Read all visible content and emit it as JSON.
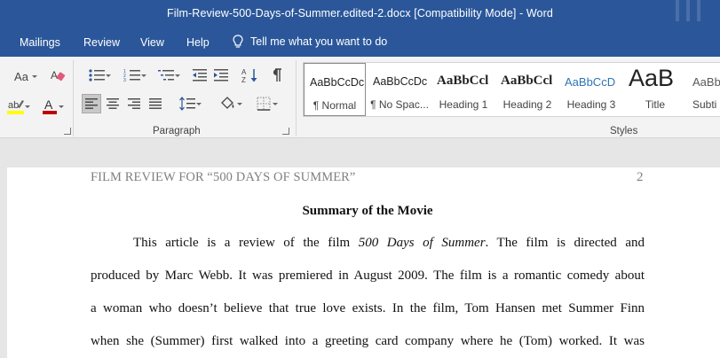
{
  "window": {
    "title": "Film-Review-500-Days-of-Summer.edited-2.docx [Compatibility Mode]  -  Word"
  },
  "menu": {
    "tabs": [
      "Mailings",
      "Review",
      "View",
      "Help"
    ],
    "tell_me": "Tell me what you want to do"
  },
  "ribbon": {
    "font_case_label": "Aa",
    "groups": {
      "paragraph": "Paragraph",
      "styles": "Styles"
    },
    "styles": [
      {
        "sample": "AaBbCcDc",
        "name": "¶ Normal"
      },
      {
        "sample": "AaBbCcDc",
        "name": "¶ No Spac..."
      },
      {
        "sample": "AaBbCcl",
        "name": "Heading 1"
      },
      {
        "sample": "AaBbCcl",
        "name": "Heading 2"
      },
      {
        "sample": "AaBbCcD",
        "name": "Heading 3"
      },
      {
        "sample": "AaB",
        "name": "Title"
      },
      {
        "sample": "AaBb",
        "name": "Subti"
      }
    ]
  },
  "document": {
    "header": "FILM REVIEW FOR “500 DAYS OF SUMMER”",
    "page_number": "2",
    "heading": "Summary of the Movie",
    "line1_a": "This article is a review of the film ",
    "line1_italic": "500 Days of Summer",
    "line1_b": ". The film is directed and",
    "line2": "produced by Marc Webb. It was premiered in August 2009. The film is a romantic comedy about",
    "line3": "a woman who doesn’t believe that true love exists. In the film, Tom Hansen met Summer Finn",
    "line4": "when she (Summer) first walked into a greeting card company where he (Tom) worked. It was"
  },
  "colors": {
    "title_bar": "#2b579a",
    "ribbon": "#f3f3f3",
    "highlight_yellow": "#ffff00",
    "font_red": "#c00000",
    "heading3_blue": "#2e74b5"
  }
}
